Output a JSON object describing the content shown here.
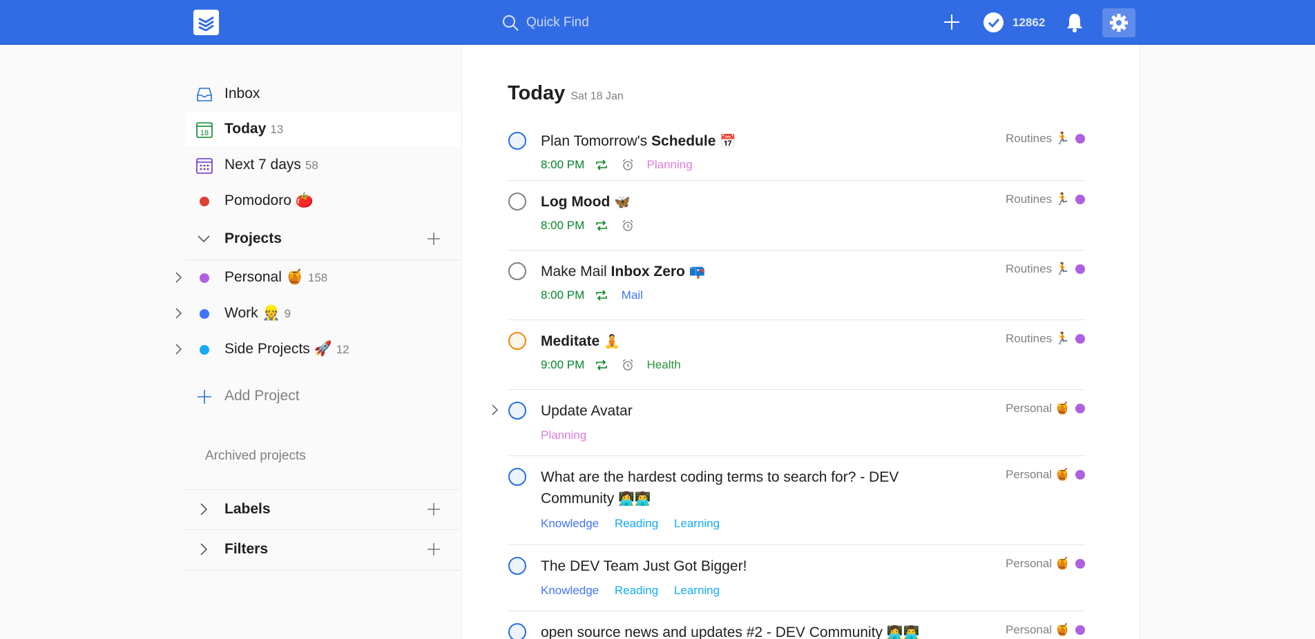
{
  "topbar": {
    "search_placeholder": "Quick Find",
    "karma": "12862"
  },
  "sidebar": {
    "nav": [
      {
        "label": "Inbox",
        "count": ""
      },
      {
        "label": "Today",
        "count": "13"
      },
      {
        "label": "Next 7 days",
        "count": "58"
      },
      {
        "label": "Pomodoro 🍅",
        "count": ""
      }
    ],
    "today_icon_day": "18",
    "projects_header": "Projects",
    "projects": [
      {
        "label": "Personal 🍯",
        "count": "158",
        "color": "#af60e0"
      },
      {
        "label": "Work 👷",
        "count": "9",
        "color": "#4073ff"
      },
      {
        "label": "Side Projects 🚀",
        "count": "12",
        "color": "#14aaf5"
      }
    ],
    "add_project": "Add Project",
    "archived": "Archived projects",
    "labels_header": "Labels",
    "filters_header": "Filters"
  },
  "main": {
    "title": "Today",
    "date": "Sat 18 Jan",
    "tasks": [
      {
        "pre": "Plan Tomorrow's ",
        "bold": "Schedule",
        "emoji": "📅",
        "time": "8:00 PM",
        "labels": [
          "Planning"
        ],
        "project": "Routines",
        "project_emoji": "🏃",
        "priority": "blue"
      },
      {
        "pre": "",
        "bold": "Log Mood",
        "emoji": "🦋",
        "time": "8:00 PM",
        "labels": [],
        "project": "Routines",
        "project_emoji": "🏃",
        "priority": "grey"
      },
      {
        "pre": "Make Mail ",
        "bold": "Inbox Zero",
        "emoji": "📪",
        "time": "8:00 PM",
        "labels": [
          "Mail"
        ],
        "project": "Routines",
        "project_emoji": "🏃",
        "priority": "grey"
      },
      {
        "pre": "",
        "bold": "Meditate",
        "emoji": "🧘",
        "time": "9:00 PM",
        "labels": [
          "Health"
        ],
        "project": "Routines",
        "project_emoji": "🏃",
        "priority": "orange"
      },
      {
        "pre": "Update Avatar",
        "bold": "",
        "emoji": "",
        "time": "",
        "labels": [
          "Planning"
        ],
        "project": "Personal",
        "project_emoji": "🍯",
        "priority": "blue"
      },
      {
        "pre": "What are the hardest coding terms to search for? - DEV Community",
        "bold": "",
        "emoji": "👩‍💻👨‍💻",
        "time": "",
        "labels": [
          "Knowledge",
          "Reading",
          "Learning"
        ],
        "project": "Personal",
        "project_emoji": "🍯",
        "priority": "blue"
      },
      {
        "pre": "The DEV Team Just Got Bigger!",
        "bold": "",
        "emoji": "",
        "time": "",
        "labels": [
          "Knowledge",
          "Reading",
          "Learning"
        ],
        "project": "Personal",
        "project_emoji": "🍯",
        "priority": "blue"
      },
      {
        "pre": "open source news and updates #2 - DEV Community",
        "bold": "",
        "emoji": "👩‍💻👨‍💻",
        "time": "",
        "labels": [],
        "project": "Personal",
        "project_emoji": "🍯",
        "priority": "blue"
      }
    ]
  },
  "colors": {
    "brand": "#326ce5",
    "time_green": "#058527",
    "label_planning": "#e07ae0",
    "label_mail": "#4073ff",
    "label_health": "#299438",
    "label_knowledge": "#4073ff",
    "label_reading": "#14aaf5",
    "label_learning": "#14aaf5"
  }
}
